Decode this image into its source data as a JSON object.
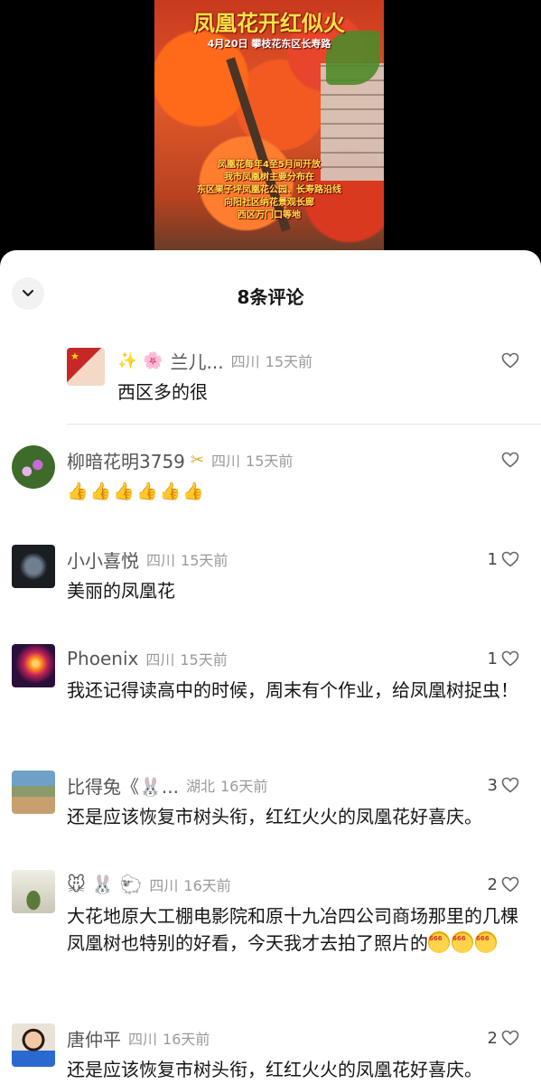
{
  "video": {
    "title": "凤凰花开红似火",
    "subtitle": "4月20日  攀枝花东区长寿路",
    "caption_lines": [
      "凤凰花每年4至5月间开放",
      "我市凤凰树主要分布在",
      "东区果子坪凤凰花公园、长寿路沿线",
      "向阳社区纳花景观长廊",
      "西区万门口等地"
    ]
  },
  "sheet": {
    "title": "8条评论"
  },
  "comments": [
    {
      "user": "兰儿...",
      "prefix_emoji": "✨ 🌸",
      "location": "四川",
      "time": "15天前",
      "likes": "",
      "text": "西区多的很",
      "avatar_colors": [
        "#c62828",
        "#f3d9c6"
      ]
    },
    {
      "user": "柳暗花明3759",
      "badge": "✂",
      "location": "四川",
      "time": "15天前",
      "likes": "",
      "text": "👍👍👍👍👍👍",
      "avatar_colors": [
        "#3f6b2a",
        "#c76bd6"
      ]
    },
    {
      "user": "小小喜悦",
      "location": "四川",
      "time": "15天前",
      "likes": "1",
      "text": "美丽的凤凰花",
      "avatar_colors": [
        "#1a1d22",
        "#6f7f90"
      ]
    },
    {
      "user": "Phoenix",
      "location": "四川",
      "time": "15天前",
      "likes": "1",
      "text": "我还记得读高中的时候，周末有个作业，给凤凰树捉虫！",
      "avatar_colors": [
        "#2a0f3a",
        "#ff8a1a"
      ]
    },
    {
      "user": "比得兔《🐰...",
      "location": "湖北",
      "time": "16天前",
      "likes": "3",
      "text": "还是应该恢复市树头衔，红红火火的凤凰花好喜庆。",
      "avatar_colors": [
        "#6fa0c8",
        "#c8a070"
      ]
    },
    {
      "user": "🐭 🐰 🐑",
      "location": "四川",
      "time": "16天前",
      "likes": "2",
      "text": "大花地原大工棚电影院和原十九冶四公司商场那里的几棵凤凰树也特别的好看，今天我才去拍了照片的",
      "avatar_colors": [
        "#d8d6c8",
        "#5b7a3a"
      ]
    },
    {
      "user": "唐仲平",
      "location": "四川",
      "time": "16天前",
      "likes": "2",
      "text": "还是应该恢复市树头衔，红红火火的凤凰花好喜庆。",
      "avatar_colors": [
        "#f1c9a6",
        "#2a6ad0"
      ]
    }
  ]
}
